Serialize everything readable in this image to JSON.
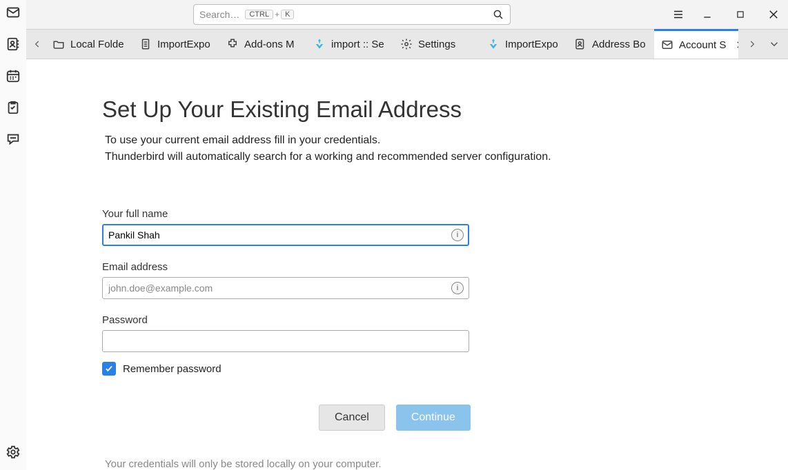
{
  "search": {
    "placeholder": "Search…",
    "shortcut": {
      "mod": "CTRL",
      "plus": "+",
      "key": "K"
    }
  },
  "tabs": [
    {
      "label": "Local Folde"
    },
    {
      "label": "ImportExpo"
    },
    {
      "label": "Add-ons M"
    },
    {
      "label": "import :: Se"
    },
    {
      "label": "Settings"
    },
    {
      "label": "ImportExpo"
    },
    {
      "label": "Address Bo"
    },
    {
      "label": "Account S"
    }
  ],
  "page": {
    "title": "Set Up Your Existing Email Address",
    "desc_line1": "To use your current email address fill in your credentials.",
    "desc_line2": "Thunderbird will automatically search for a working and recommended server configuration."
  },
  "form": {
    "name_label": "Your full name",
    "name_value": "Pankil Shah",
    "email_label": "Email address",
    "email_placeholder": "john.doe@example.com",
    "email_value": "",
    "password_label": "Password",
    "password_value": "",
    "remember_label": "Remember password",
    "remember_checked": true
  },
  "buttons": {
    "cancel": "Cancel",
    "continue": "Continue"
  },
  "footer": "Your credentials will only be stored locally on your computer."
}
